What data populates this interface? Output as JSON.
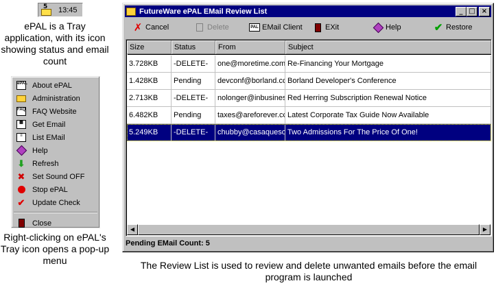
{
  "tray": {
    "count": "5",
    "time": "13:45",
    "icon": "epal-envelope-icon"
  },
  "captions": {
    "tray": "ePAL is a Tray application, with its icon showing status and email count",
    "menu": "Right-clicking on ePAL's Tray icon opens a pop-up menu",
    "list": "The Review List is used to review and delete unwanted emails before the email program is launched"
  },
  "menu": {
    "items": [
      {
        "label": "About ePAL",
        "icon": "about-icon"
      },
      {
        "label": "Administration",
        "icon": "folder-icon"
      },
      {
        "label": "FAQ Website",
        "icon": "faq-icon"
      },
      {
        "label": "Get Email",
        "icon": "get-email-icon"
      },
      {
        "label": "List EMail",
        "icon": "list-icon"
      },
      {
        "label": "Help",
        "icon": "help-icon"
      },
      {
        "label": "Refresh",
        "icon": "refresh-icon"
      },
      {
        "label": "Set Sound OFF",
        "icon": "sound-icon"
      },
      {
        "label": "Stop ePAL",
        "icon": "stop-icon"
      },
      {
        "label": "Update Check",
        "icon": "check-icon"
      }
    ],
    "close_label": "Close"
  },
  "window": {
    "title": "FutureWare ePAL EMail Review List",
    "toolbar": {
      "cancel": "Cancel",
      "delete": "Delete",
      "email_client": "EMail Client",
      "exit": "EXit",
      "help": "Help",
      "restore": "Restore"
    },
    "columns": {
      "size": "Size",
      "status": "Status",
      "from": "From",
      "subject": "Subject"
    },
    "rows": [
      {
        "size": "3.728KB",
        "status": "-DELETE-",
        "from": "one@moretime.com",
        "subject": "Re-Financing Your Mortgage"
      },
      {
        "size": "1.428KB",
        "status": "Pending",
        "from": "devconf@borland.cc",
        "subject": "Borland Developer's Conference"
      },
      {
        "size": "2.713KB",
        "status": "-DELETE-",
        "from": "nolonger@inbusines",
        "subject": "Red Herring Subscription Renewal Notice"
      },
      {
        "size": "6.482KB",
        "status": "Pending",
        "from": "taxes@areforever.cc",
        "subject": "Latest Corporate Tax Guide Now Available"
      },
      {
        "size": "5.249KB",
        "status": "-DELETE-",
        "from": "chubby@casaqueso",
        "subject": "Two Admissions For The Price Of One!"
      }
    ],
    "status": "Pending EMail Count: 5"
  },
  "colors": {
    "titlebar": "#000080",
    "selection": "#000080",
    "chrome": "#c0c0c0"
  }
}
